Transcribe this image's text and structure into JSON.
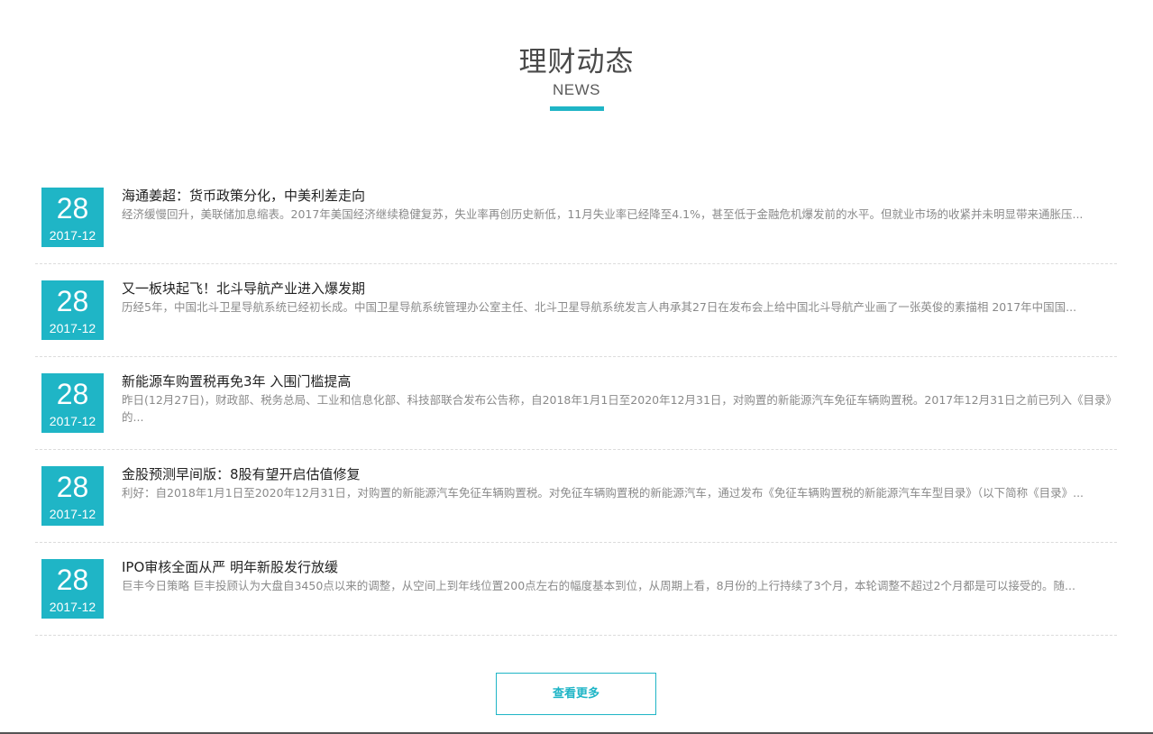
{
  "header": {
    "title": "理财动态",
    "subtitle": "NEWS"
  },
  "news": [
    {
      "day": "28",
      "year_month": "2017-12",
      "title": "海通姜超：货币政策分化，中美利差走向",
      "desc": "经济缓慢回升，美联储加息缩表。2017年美国经济继续稳健复苏，失业率再创历史新低，11月失业率已经降至4.1%，甚至低于金融危机爆发前的水平。但就业市场的收紧并未明显带来通胀压..."
    },
    {
      "day": "28",
      "year_month": "2017-12",
      "title": "又一板块起飞！北斗导航产业进入爆发期",
      "desc": "历经5年，中国北斗卫星导航系统已经初长成。中国卫星导航系统管理办公室主任、北斗卫星导航系统发言人冉承其27日在发布会上给中国北斗导航产业画了一张英俊的素描相 2017年中国国..."
    },
    {
      "day": "28",
      "year_month": "2017-12",
      "title": "新能源车购置税再免3年 入围门槛提高",
      "desc": "昨日(12月27日)，财政部、税务总局、工业和信息化部、科技部联合发布公告称，自2018年1月1日至2020年12月31日，对购置的新能源汽车免征车辆购置税。2017年12月31日之前已列入《目录》的..."
    },
    {
      "day": "28",
      "year_month": "2017-12",
      "title": "金股预测早间版：8股有望开启估值修复",
      "desc": "利好：自2018年1月1日至2020年12月31日，对购置的新能源汽车免征车辆购置税。对免征车辆购置税的新能源汽车，通过发布《免征车辆购置税的新能源汽车车型目录》（以下简称《目录》..."
    },
    {
      "day": "28",
      "year_month": "2017-12",
      "title": "IPO审核全面从严 明年新股发行放缓",
      "desc": "巨丰今日策略 巨丰投顾认为大盘自3450点以来的调整，从空间上到年线位置200点左右的幅度基本到位，从周期上看，8月份的上行持续了3个月，本轮调整不超过2个月都是可以接受的。随..."
    }
  ],
  "more_button": {
    "label": "查看更多"
  },
  "colors": {
    "accent": "#1fb5c6",
    "title_text": "#4a4a4a",
    "desc_text": "#8a8a8a"
  }
}
